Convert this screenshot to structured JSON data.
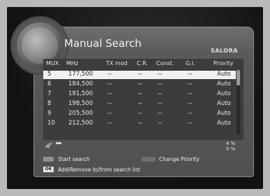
{
  "title": "Manual Search",
  "brand": "SALORA",
  "columns": {
    "mux": "MUX",
    "mhz": "MHz",
    "tx_mod": "TX mod",
    "cr": "C.R.",
    "const": "Const.",
    "gi": "G.I.",
    "priority": "Priority"
  },
  "rows": [
    {
      "mux": "5",
      "mhz": "177,500",
      "tx": "--",
      "cr": "--",
      "const": "--",
      "gi": "--",
      "priority": "Auto",
      "selected": true
    },
    {
      "mux": "6",
      "mhz": "184,500",
      "tx": "--",
      "cr": "--",
      "const": "--",
      "gi": "--",
      "priority": "Auto"
    },
    {
      "mux": "7",
      "mhz": "191,500",
      "tx": "--",
      "cr": "--",
      "const": "--",
      "gi": "--",
      "priority": "Auto"
    },
    {
      "mux": "8",
      "mhz": "198,500",
      "tx": "--",
      "cr": "--",
      "const": "--",
      "gi": "--",
      "priority": "Auto"
    },
    {
      "mux": "9",
      "mhz": "205,500",
      "tx": "--",
      "cr": "--",
      "const": "--",
      "gi": "--",
      "priority": "Auto"
    },
    {
      "mux": "10",
      "mhz": "212,500",
      "tx": "--",
      "cr": "--",
      "const": "--",
      "gi": "--",
      "priority": "Auto"
    }
  ],
  "signal": {
    "level": "4 %",
    "quality": "0 %"
  },
  "legend": {
    "start_search": "Start search",
    "change_priority": "Change Priority",
    "ok_key": "OK",
    "add_remove": "Add/Remove to/from search list"
  },
  "colors": {
    "key_start": "#8f8f8f",
    "key_change": "#6e6e6e"
  }
}
